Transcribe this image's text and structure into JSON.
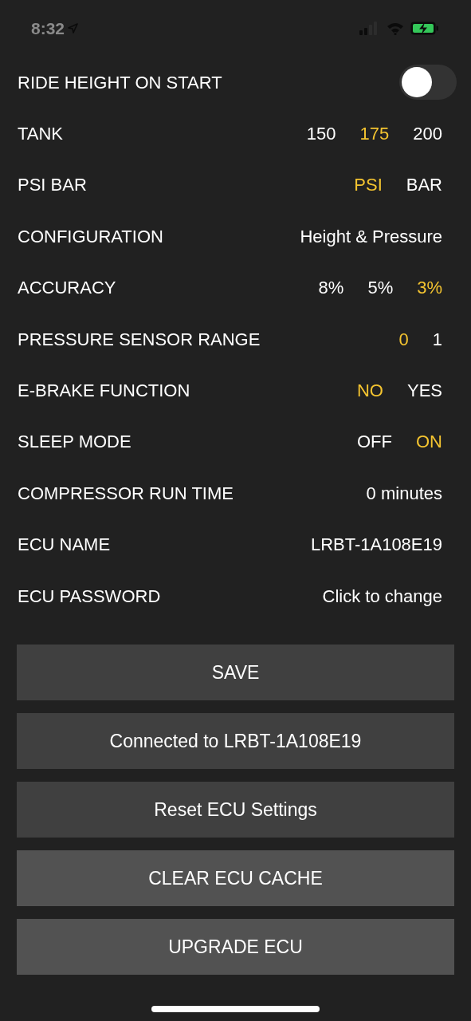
{
  "status_bar": {
    "time": "8:32"
  },
  "settings": [
    {
      "kind": "toggle",
      "label": "RIDE HEIGHT ON START",
      "on": false
    },
    {
      "kind": "options",
      "label": "TANK",
      "options": [
        {
          "label": "150",
          "selected": false
        },
        {
          "label": "175",
          "selected": true
        },
        {
          "label": "200",
          "selected": false
        }
      ]
    },
    {
      "kind": "options",
      "label": "PSI BAR",
      "options": [
        {
          "label": "PSI",
          "selected": true
        },
        {
          "label": "BAR",
          "selected": false
        }
      ]
    },
    {
      "kind": "value",
      "label": "CONFIGURATION",
      "value": "Height & Pressure"
    },
    {
      "kind": "options",
      "label": "ACCURACY",
      "options": [
        {
          "label": "8%",
          "selected": false
        },
        {
          "label": "5%",
          "selected": false
        },
        {
          "label": "3%",
          "selected": true
        }
      ]
    },
    {
      "kind": "options",
      "label": "PRESSURE SENSOR RANGE",
      "options": [
        {
          "label": "0",
          "selected": true
        },
        {
          "label": "1",
          "selected": false
        }
      ]
    },
    {
      "kind": "options",
      "label": "E-BRAKE FUNCTION",
      "options": [
        {
          "label": "NO",
          "selected": true
        },
        {
          "label": "YES",
          "selected": false
        }
      ]
    },
    {
      "kind": "options",
      "label": "SLEEP MODE",
      "options": [
        {
          "label": "OFF",
          "selected": false
        },
        {
          "label": "ON",
          "selected": true
        }
      ]
    },
    {
      "kind": "value",
      "label": "COMPRESSOR RUN TIME",
      "value": "0 minutes"
    },
    {
      "kind": "value",
      "label": "ECU NAME",
      "value": "LRBT-1A108E19"
    },
    {
      "kind": "value",
      "label": "ECU PASSWORD",
      "value": "Click to change"
    }
  ],
  "buttons": [
    {
      "label": "SAVE",
      "kind": "primary"
    },
    {
      "label": "Connected to LRBT-1A108E19",
      "kind": "primary"
    },
    {
      "label": "Reset ECU Settings",
      "kind": "primary"
    },
    {
      "label": "CLEAR ECU CACHE",
      "kind": "secondary"
    },
    {
      "label": "UPGRADE ECU",
      "kind": "secondary"
    }
  ]
}
